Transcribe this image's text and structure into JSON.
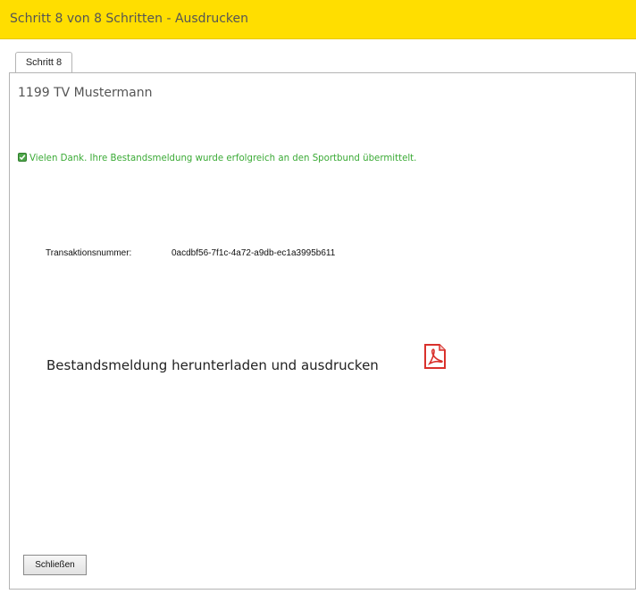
{
  "window": {
    "title": "Schritt 8 von 8 Schritten - Ausdrucken"
  },
  "tabs": [
    {
      "label": "Schritt 8",
      "active": true
    }
  ],
  "main": {
    "org_name": "1199 TV Mustermann",
    "success_message": "Vielen Dank. Ihre Bestandsmeldung wurde erfolgreich an den Sportbund übermittelt.",
    "transaction_label": "Transaktionsnummer:",
    "transaction_number": "0acdbf56-7f1c-4a72-a9db-ec1a3995b611",
    "download_label": "Bestandsmeldung herunterladen und ausdrucken",
    "download_icon": "pdf-icon"
  },
  "footer": {
    "close_label": "Schließen"
  },
  "colors": {
    "titlebar": "#ffde00",
    "success": "#3aaa35",
    "pdf": "#d9312c"
  }
}
